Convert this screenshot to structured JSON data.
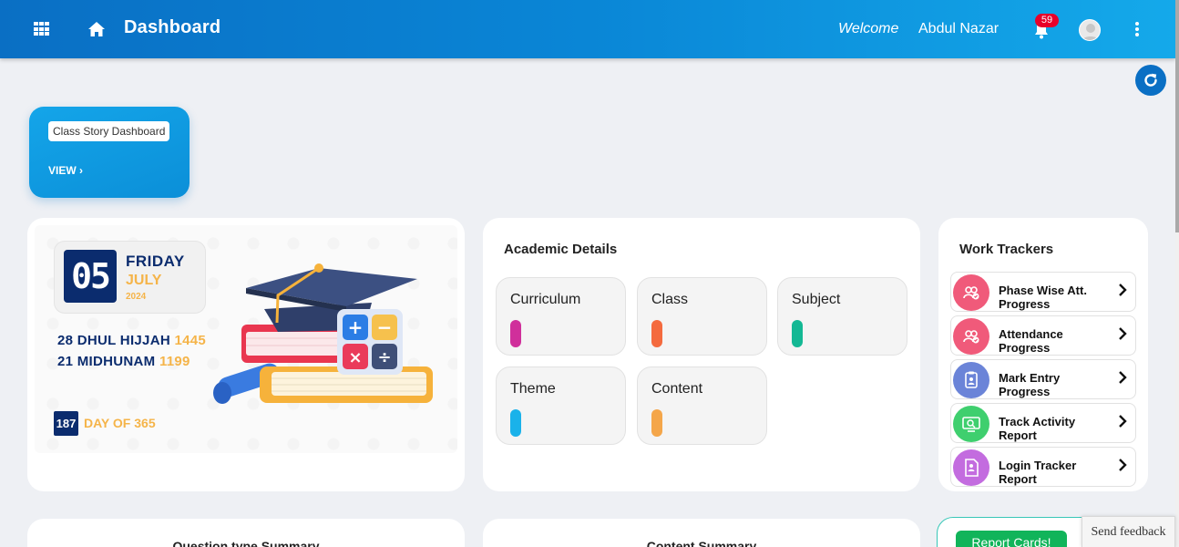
{
  "header": {
    "title": "Dashboard",
    "welcome": "Welcome",
    "username": "Abdul Nazar",
    "notification_count": "59",
    "icons": [
      "apps-grid-icon",
      "home-icon",
      "bell-icon",
      "avatar",
      "kebab-menu-icon",
      "refresh-icon"
    ]
  },
  "story_card": {
    "label": "Class Story Dashboard",
    "view": "VIEW"
  },
  "date_card": {
    "day": "05",
    "weekday": "FRIDAY",
    "month": "JULY",
    "year": "2024",
    "hijri_date": "28 DHUL HIJJAH",
    "hijri_year": "1445",
    "malayalam_date": "21 MIDHUNAM",
    "malayalam_year": "1199",
    "day_of_year": "187",
    "day_of_year_label": "DAY OF 365"
  },
  "academic": {
    "title": "Academic Details",
    "tiles": [
      {
        "label": "Curriculum",
        "color": "#d02f9b"
      },
      {
        "label": "Class",
        "color": "#f46a3e"
      },
      {
        "label": "Subject",
        "color": "#14b894"
      },
      {
        "label": "Theme",
        "color": "#1ab2ea"
      },
      {
        "label": "Content",
        "color": "#f4a64a"
      }
    ]
  },
  "trackers": {
    "title": "Work Trackers",
    "items": [
      {
        "line1": "Phase Wise Att.",
        "line2": "Progress",
        "color": "#f05a7a",
        "icon": "users-check-icon"
      },
      {
        "line1": "Attendance",
        "line2": "Progress",
        "color": "#f05a7a",
        "icon": "users-check-icon"
      },
      {
        "line1": "Mark Entry",
        "line2": "Progress",
        "color": "#6b84d8",
        "icon": "clipboard-icon"
      },
      {
        "line1": "Track Activity",
        "line2": "Report",
        "color": "#3fcf6e",
        "icon": "monitor-search-icon"
      },
      {
        "line1": "Login Tracker",
        "line2": "Report",
        "color": "#c36cdf",
        "icon": "document-user-icon"
      }
    ]
  },
  "bottom": {
    "question_summary": "Question type Summary",
    "content_summary": "Content Summary",
    "report_cards": "Report Cards!"
  },
  "feedback": "Send feedback"
}
